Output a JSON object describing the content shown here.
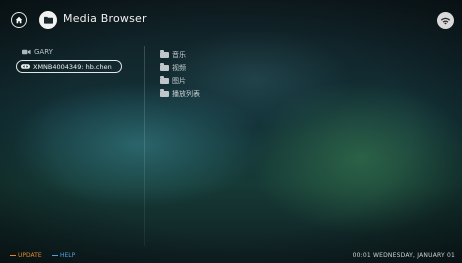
{
  "header": {
    "title": "Media Browser"
  },
  "sidebar": {
    "device_label": "GARY",
    "server": "XMNB4004349: hb.chen"
  },
  "folders": [
    {
      "label": "音乐"
    },
    {
      "label": "视频"
    },
    {
      "label": "图片"
    },
    {
      "label": "播放列表"
    }
  ],
  "footer": {
    "update_label": "UPDATE",
    "help_label": "HELP",
    "clock": "00:01  WEDNESDAY, JANUARY 01"
  },
  "colors": {
    "update": "#e58a2a",
    "help": "#4da3e0"
  },
  "icons": {
    "home": "home-icon",
    "folder": "folder-icon",
    "wifi": "wifi-icon",
    "device": "device-icon",
    "network": "network-icon"
  }
}
